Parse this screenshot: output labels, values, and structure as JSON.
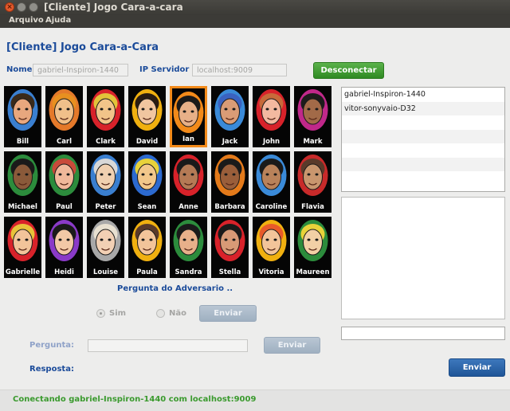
{
  "window": {
    "title": "[Cliente] Jogo Cara-a-cara"
  },
  "menu": {
    "items": [
      "Arquivo",
      "Ajuda"
    ]
  },
  "header": {
    "title": "[Cliente] Jogo Cara-a-Cara"
  },
  "connection": {
    "name_label": "Nome",
    "name_value": "gabriel-Inspiron-1440",
    "server_label": "IP Servidor",
    "server_value": "localhost:9009",
    "disconnect_label": "Desconectar"
  },
  "colors": {
    "accent_blue": "#1b4b9a",
    "green_button": "#3f9d33",
    "selected_border": "#f28a1a",
    "status_green": "#3a9a2e"
  },
  "characters": [
    {
      "name": "Bill",
      "skin": "#e8a77e",
      "hair": "#3a2a1a",
      "bg": "#3a7fd0"
    },
    {
      "name": "Carl",
      "skin": "#f0c08a",
      "hair": "#e89020",
      "bg": "#e4792a"
    },
    {
      "name": "Clark",
      "skin": "#f2c489",
      "hair": "#e2c23a",
      "bg": "#d8222a"
    },
    {
      "name": "David",
      "skin": "#f1c6a0",
      "hair": "#2a1c12",
      "bg": "#f0b010"
    },
    {
      "name": "Ian",
      "skin": "#e7b088",
      "hair": "#1a1a1a",
      "bg": "#f28a1a",
      "selected": true
    },
    {
      "name": "Jack",
      "skin": "#d99c76",
      "hair": "#3a62c0",
      "bg": "#3a8ad8"
    },
    {
      "name": "John",
      "skin": "#f3b9a0",
      "hair": "#c76a3a",
      "bg": "#d8222a"
    },
    {
      "name": "Mark",
      "skin": "#a26a48",
      "hair": "#1c1c1c",
      "bg": "#c0288a"
    },
    {
      "name": "Michael",
      "skin": "#8a5a3a",
      "hair": "#1a1a1a",
      "bg": "#2c8c3c"
    },
    {
      "name": "Paul",
      "skin": "#f0b89a",
      "hair": "#c84a3a",
      "bg": "#2c8c3c"
    },
    {
      "name": "Peter",
      "skin": "#f0d0b0",
      "hair": "#d8d8d8",
      "bg": "#3a7fd0"
    },
    {
      "name": "Sean",
      "skin": "#f2c78a",
      "hair": "#e8d23a",
      "bg": "#2c6ad0"
    },
    {
      "name": "Anne",
      "skin": "#b57a55",
      "hair": "#1a1a1a",
      "bg": "#d8222a"
    },
    {
      "name": "Barbara",
      "skin": "#9a5e3a",
      "hair": "#1a1a1a",
      "bg": "#e47a1a"
    },
    {
      "name": "Caroline",
      "skin": "#b9825a",
      "hair": "#1a1a1a",
      "bg": "#3a8ad8"
    },
    {
      "name": "Flavia",
      "skin": "#c9966e",
      "hair": "#5a3a2a",
      "bg": "#c82a2a"
    },
    {
      "name": "Gabrielle",
      "skin": "#f2c49a",
      "hair": "#e8c23a",
      "bg": "#d8222a"
    },
    {
      "name": "Heidi",
      "skin": "#f2c8a6",
      "hair": "#1a1a1a",
      "bg": "#8a3ac8"
    },
    {
      "name": "Louise",
      "skin": "#f2d0b4",
      "hair": "#e8e0d0",
      "bg": "#a8a8a8"
    },
    {
      "name": "Paula",
      "skin": "#f2c49a",
      "hair": "#5a3a2a",
      "bg": "#f0b010"
    },
    {
      "name": "Sandra",
      "skin": "#e8b08a",
      "hair": "#1a1a1a",
      "bg": "#2c8c3c"
    },
    {
      "name": "Stella",
      "skin": "#d89a76",
      "hair": "#1a1a1a",
      "bg": "#d8222a"
    },
    {
      "name": "Vitoria",
      "skin": "#f2c49a",
      "hair": "#e85a2a",
      "bg": "#f0b010"
    },
    {
      "name": "Maureen",
      "skin": "#f2d0a6",
      "hair": "#e8d23a",
      "bg": "#2c8c3c"
    }
  ],
  "question_panel": {
    "title": "Pergunta do Adversario ..",
    "yes_label": "Sim",
    "no_label": "Não",
    "send_answer_label": "Enviar",
    "question_label": "Pergunta:",
    "question_value": "",
    "send_question_label": "Enviar",
    "answer_label": "Resposta:"
  },
  "players": [
    "gabriel-Inspiron-1440",
    "vitor-sonyvaio-D32",
    "",
    "",
    "",
    "",
    ""
  ],
  "chat": {
    "send_label": "Enviar",
    "input_value": ""
  },
  "status": {
    "text": "Conectando gabriel-Inspiron-1440 com localhost:9009"
  }
}
